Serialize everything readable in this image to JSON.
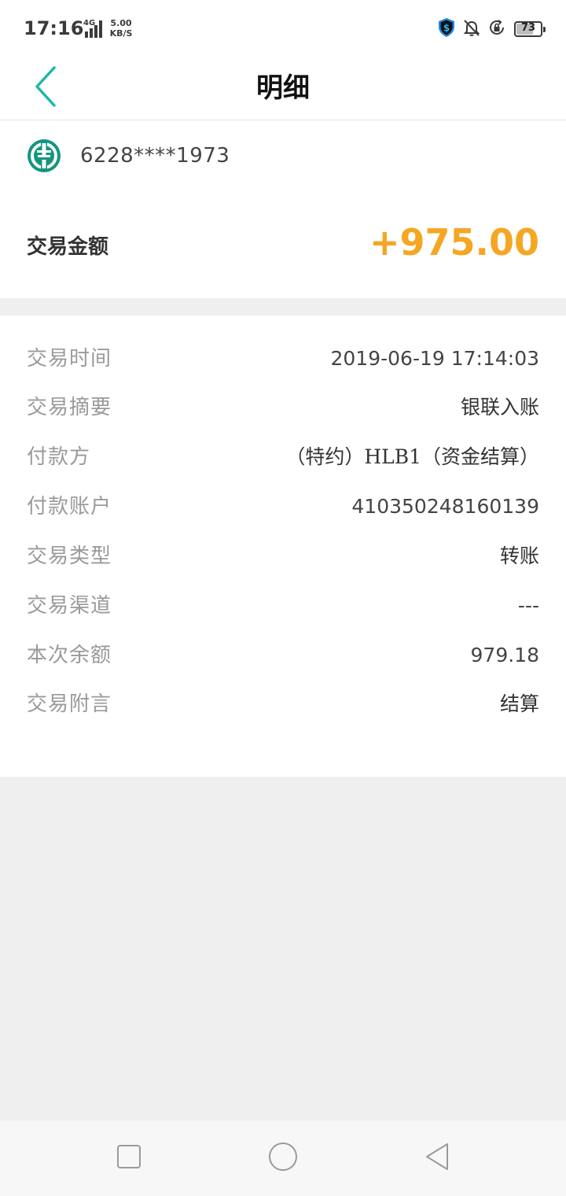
{
  "status_bar": {
    "time": "17:16",
    "network": "4G",
    "speed_value": "5.00",
    "speed_unit": "KB/S",
    "battery_level": "73"
  },
  "header": {
    "title": "明细"
  },
  "account": {
    "card_number": "6228****1973"
  },
  "amount": {
    "label": "交易金额",
    "value": "+975.00"
  },
  "details": [
    {
      "label": "交易时间",
      "value": "2019-06-19 17:14:03"
    },
    {
      "label": "交易摘要",
      "value": "银联入账"
    },
    {
      "label": "付款方",
      "value": "（特约）HLB1（资金结算）"
    },
    {
      "label": "付款账户",
      "value": "410350248160139"
    },
    {
      "label": "交易类型",
      "value": "转账"
    },
    {
      "label": "交易渠道",
      "value": "---"
    },
    {
      "label": "本次余额",
      "value": "979.18"
    },
    {
      "label": "交易附言",
      "value": "结算"
    }
  ],
  "colors": {
    "accent": "#1fb7a6",
    "amount": "#f5a623",
    "bank_logo": "#14957f"
  }
}
